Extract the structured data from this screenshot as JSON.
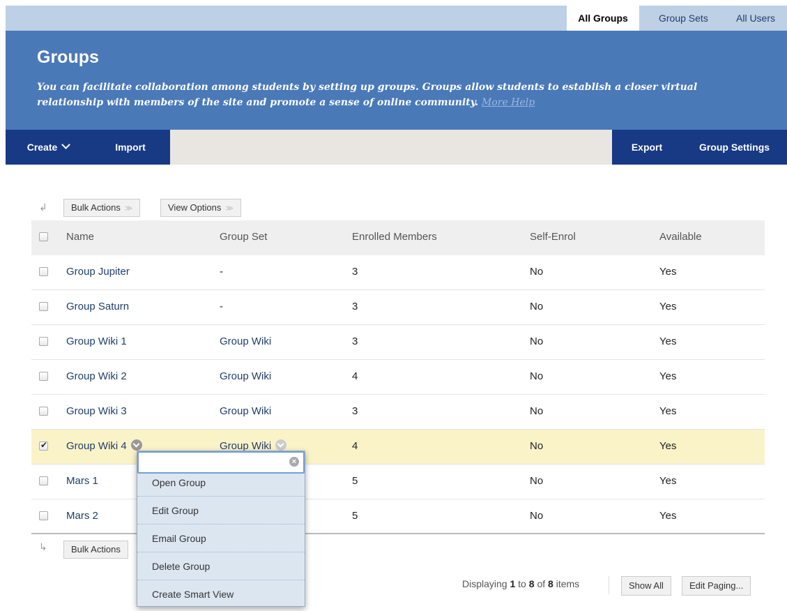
{
  "tabs": [
    {
      "label": "All Groups",
      "active": true
    },
    {
      "label": "Group Sets",
      "active": false
    },
    {
      "label": "All Users",
      "active": false
    }
  ],
  "hero": {
    "title": "Groups",
    "description": "You can facilitate collaboration among students by setting up groups. Groups allow students to establish a closer virtual relationship with members of the site and promote a sense of online community.",
    "help_link": "More Help"
  },
  "actionbar": {
    "create": "Create",
    "import": "Import",
    "export": "Export",
    "group_settings": "Group Settings"
  },
  "toolbar": {
    "bulk_actions": "Bulk Actions",
    "view_options": "View Options"
  },
  "table": {
    "headers": [
      "Name",
      "Group Set",
      "Enrolled Members",
      "Self-Enrol",
      "Available"
    ],
    "rows": [
      {
        "name": "Group Jupiter",
        "group_set": "-",
        "enrolled": "3",
        "self_enrol": "No",
        "available": "Yes",
        "checked": false
      },
      {
        "name": "Group Saturn",
        "group_set": "-",
        "enrolled": "3",
        "self_enrol": "No",
        "available": "Yes",
        "checked": false
      },
      {
        "name": "Group Wiki 1",
        "group_set": "Group Wiki",
        "enrolled": "3",
        "self_enrol": "No",
        "available": "Yes",
        "checked": false
      },
      {
        "name": "Group Wiki 2",
        "group_set": "Group Wiki",
        "enrolled": "4",
        "self_enrol": "No",
        "available": "Yes",
        "checked": false
      },
      {
        "name": "Group Wiki 3",
        "group_set": "Group Wiki",
        "enrolled": "3",
        "self_enrol": "No",
        "available": "Yes",
        "checked": false
      },
      {
        "name": "Group Wiki 4",
        "group_set": "Group Wiki",
        "enrolled": "4",
        "self_enrol": "No",
        "available": "Yes",
        "checked": true
      },
      {
        "name": "Mars 1",
        "group_set": "",
        "enrolled": "5",
        "self_enrol": "No",
        "available": "Yes",
        "checked": false
      },
      {
        "name": "Mars 2",
        "group_set": "",
        "enrolled": "5",
        "self_enrol": "No",
        "available": "Yes",
        "checked": false
      }
    ]
  },
  "context_menu": {
    "items": [
      "Open Group",
      "Edit Group",
      "Email Group",
      "Delete Group",
      "Create Smart View"
    ]
  },
  "paging": {
    "prefix": "Displaying",
    "from": "1",
    "to_word": "to",
    "to": "8",
    "of_word": "of",
    "total": "8",
    "suffix": "items",
    "show_all": "Show All",
    "edit_paging": "Edit Paging..."
  },
  "colors": {
    "hero_bg": "#4a79b8",
    "actionbar_btn": "#183a85",
    "selected_row": "#fbf3c8",
    "link": "#1f3e6b"
  }
}
